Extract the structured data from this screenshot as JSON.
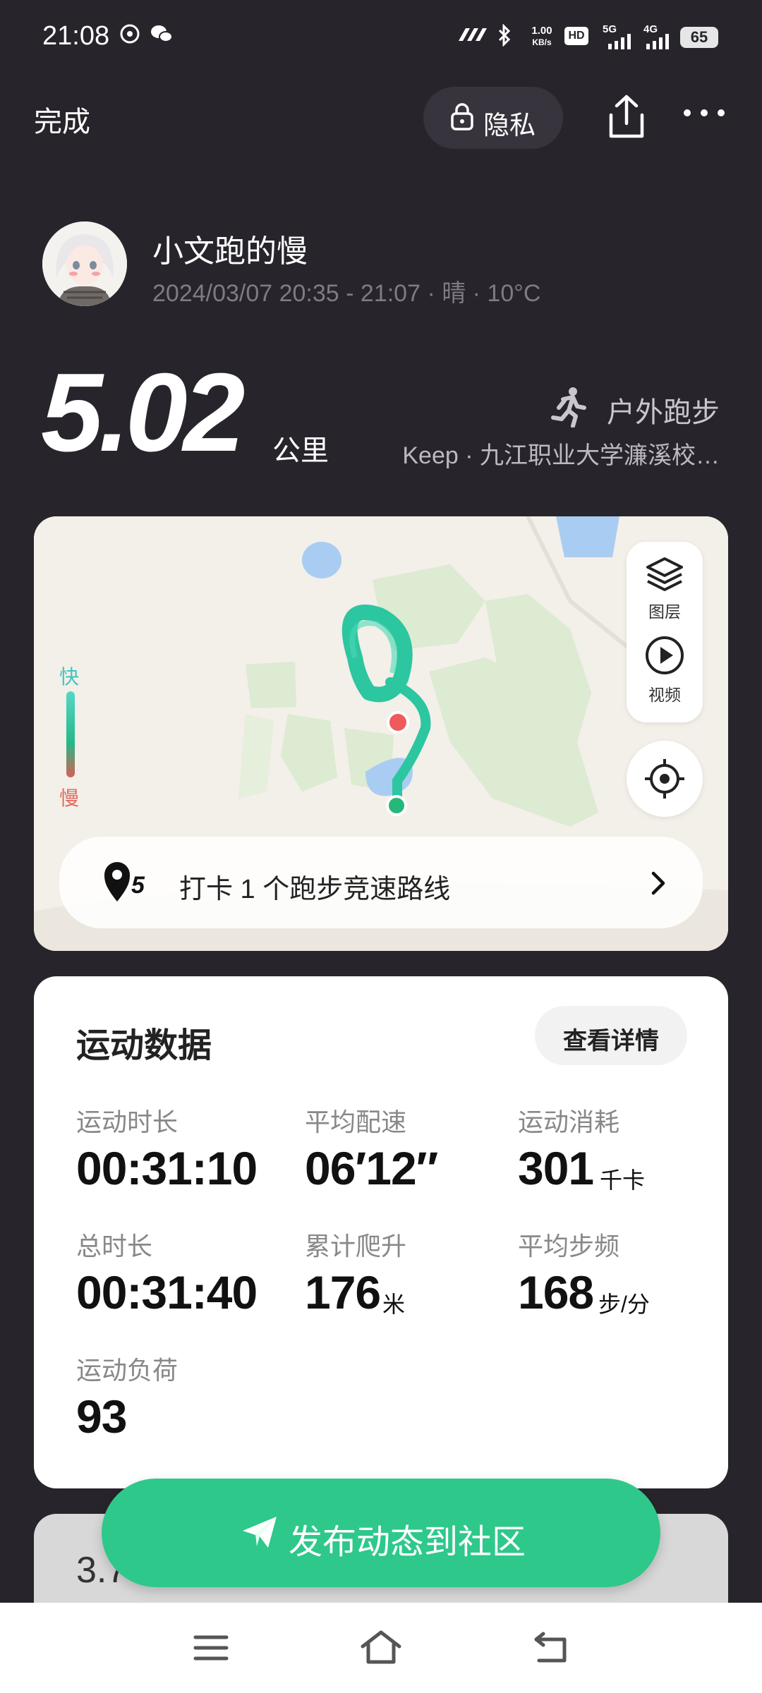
{
  "status_bar": {
    "time": "21:08",
    "net_speed_value": "1.00",
    "net_speed_unit": "KB/s",
    "hd_label": "HD",
    "sim1_label": "5G",
    "sim2_label": "4G",
    "battery_level": "65"
  },
  "header": {
    "done_label": "完成",
    "privacy_label": "隐私"
  },
  "profile": {
    "username": "小文跑的慢",
    "meta": "2024/03/07 20:35 - 21:07 · 晴 · 10°C"
  },
  "summary": {
    "distance": "5.02",
    "distance_unit": "公里",
    "sport_type": "户外跑步",
    "source": "Keep · 九江职业大学濂溪校…"
  },
  "map": {
    "legend_fast": "快",
    "legend_slow": "慢",
    "layers_label": "图层",
    "video_label": "视频",
    "checkin_text": "打卡 1 个跑步竞速路线",
    "route_color": "#2cc6a0",
    "start_color": "#25b87a",
    "end_color": "#ef5a5a"
  },
  "stats": {
    "title": "运动数据",
    "detail_button": "查看详情",
    "items": [
      {
        "label": "运动时长",
        "value": "00:31:10",
        "unit": ""
      },
      {
        "label": "平均配速",
        "value": "06′12″",
        "unit": ""
      },
      {
        "label": "运动消耗",
        "value": "301",
        "unit": "千卡"
      },
      {
        "label": "总时长",
        "value": "00:31:40",
        "unit": ""
      },
      {
        "label": "累计爬升",
        "value": "176",
        "unit": "米"
      },
      {
        "label": "平均步频",
        "value": "168",
        "unit": "步/分"
      },
      {
        "label": "运动负荷",
        "value": "93",
        "unit": ""
      }
    ]
  },
  "next_card": {
    "title_partial": "3.7"
  },
  "publish_button": "发布动态到社区",
  "colors": {
    "background": "#27242b",
    "accent_green": "#2ec88a"
  }
}
